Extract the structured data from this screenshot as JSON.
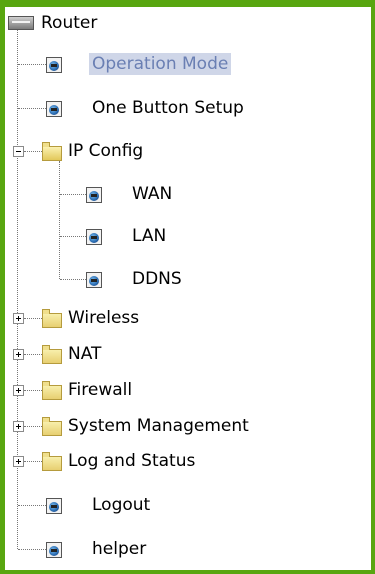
{
  "tree": {
    "root": {
      "label": "Router",
      "icon": "router-icon"
    },
    "items": [
      {
        "label": "Operation Mode",
        "type": "page",
        "selected": true
      },
      {
        "label": "One Button Setup",
        "type": "page"
      },
      {
        "label": "IP Config",
        "type": "folder",
        "expanded": true,
        "children": [
          {
            "label": "WAN",
            "type": "page"
          },
          {
            "label": "LAN",
            "type": "page"
          },
          {
            "label": "DDNS",
            "type": "page"
          }
        ]
      },
      {
        "label": "Wireless",
        "type": "folder",
        "expanded": false
      },
      {
        "label": "NAT",
        "type": "folder",
        "expanded": false
      },
      {
        "label": "Firewall",
        "type": "folder",
        "expanded": false
      },
      {
        "label": "System Management",
        "type": "folder",
        "expanded": false
      },
      {
        "label": "Log and Status",
        "type": "folder",
        "expanded": false
      },
      {
        "label": "Logout",
        "type": "page"
      },
      {
        "label": "helper",
        "type": "page"
      }
    ]
  },
  "colors": {
    "frame": "#58a610",
    "selected_bg": "#cfd6e8",
    "selected_text": "#6a7fb3"
  }
}
